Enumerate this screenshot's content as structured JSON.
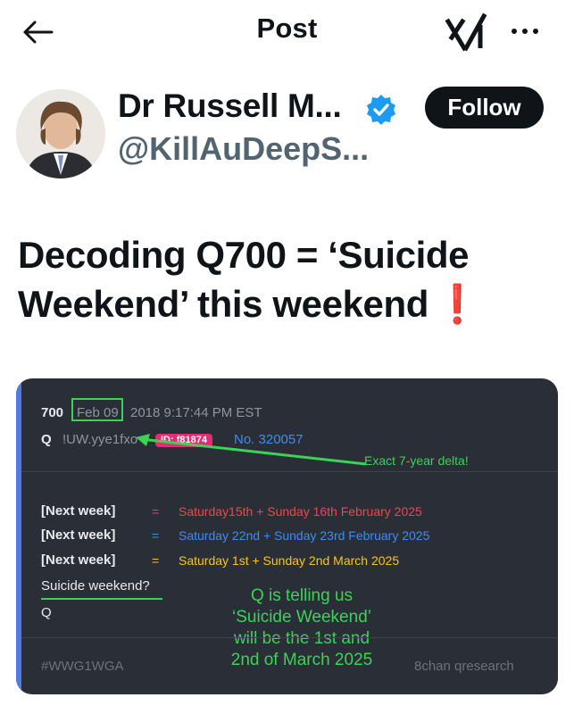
{
  "header": {
    "title": "Post"
  },
  "author": {
    "display_name": "Dr Russell M...",
    "handle": "@KillAuDeepS...",
    "follow_label": "Follow",
    "verified_color": "#1d9bf0"
  },
  "post": {
    "text_line1": "Decoding Q700 = ‘Suicide",
    "text_line2": "Weekend’ this weekend",
    "emoji": "❗"
  },
  "media": {
    "post_number": "700",
    "date_highlight": "Feb 09",
    "date_rest": "2018 9:17:44 PM EST",
    "q_label": "Q",
    "tripcode": "!UW.yye1fxo",
    "id_badge": "ID: f81874",
    "post_no": "No. 320057",
    "arrow_note": "Exact 7-year delta!",
    "rows": [
      {
        "label": "[Next week]",
        "eq": "=",
        "text": "Saturday15th + Sunday 16th February 2025",
        "color": "#f2444a"
      },
      {
        "label": "[Next week]",
        "eq": "=",
        "text": "Saturday 22nd + Sunday 23rd February 2025",
        "color": "#3f8bf0"
      },
      {
        "label": "[Next week]",
        "eq": "=",
        "text": "Saturday 1st + Sunday 2nd March 2025",
        "color": "#f4c51f"
      }
    ],
    "suicide_line": "Suicide weekend?",
    "q_sign": "Q",
    "explain_1": "Q is telling us",
    "explain_2": "‘Suicide Weekend’",
    "explain_3": "will be the 1st and",
    "explain_4": "2nd of March 2025",
    "footer_left": "#WWG1WGA",
    "footer_right": "8chan qresearch",
    "accent_color": "#4e7de0",
    "highlight_color": "#3cd256"
  }
}
